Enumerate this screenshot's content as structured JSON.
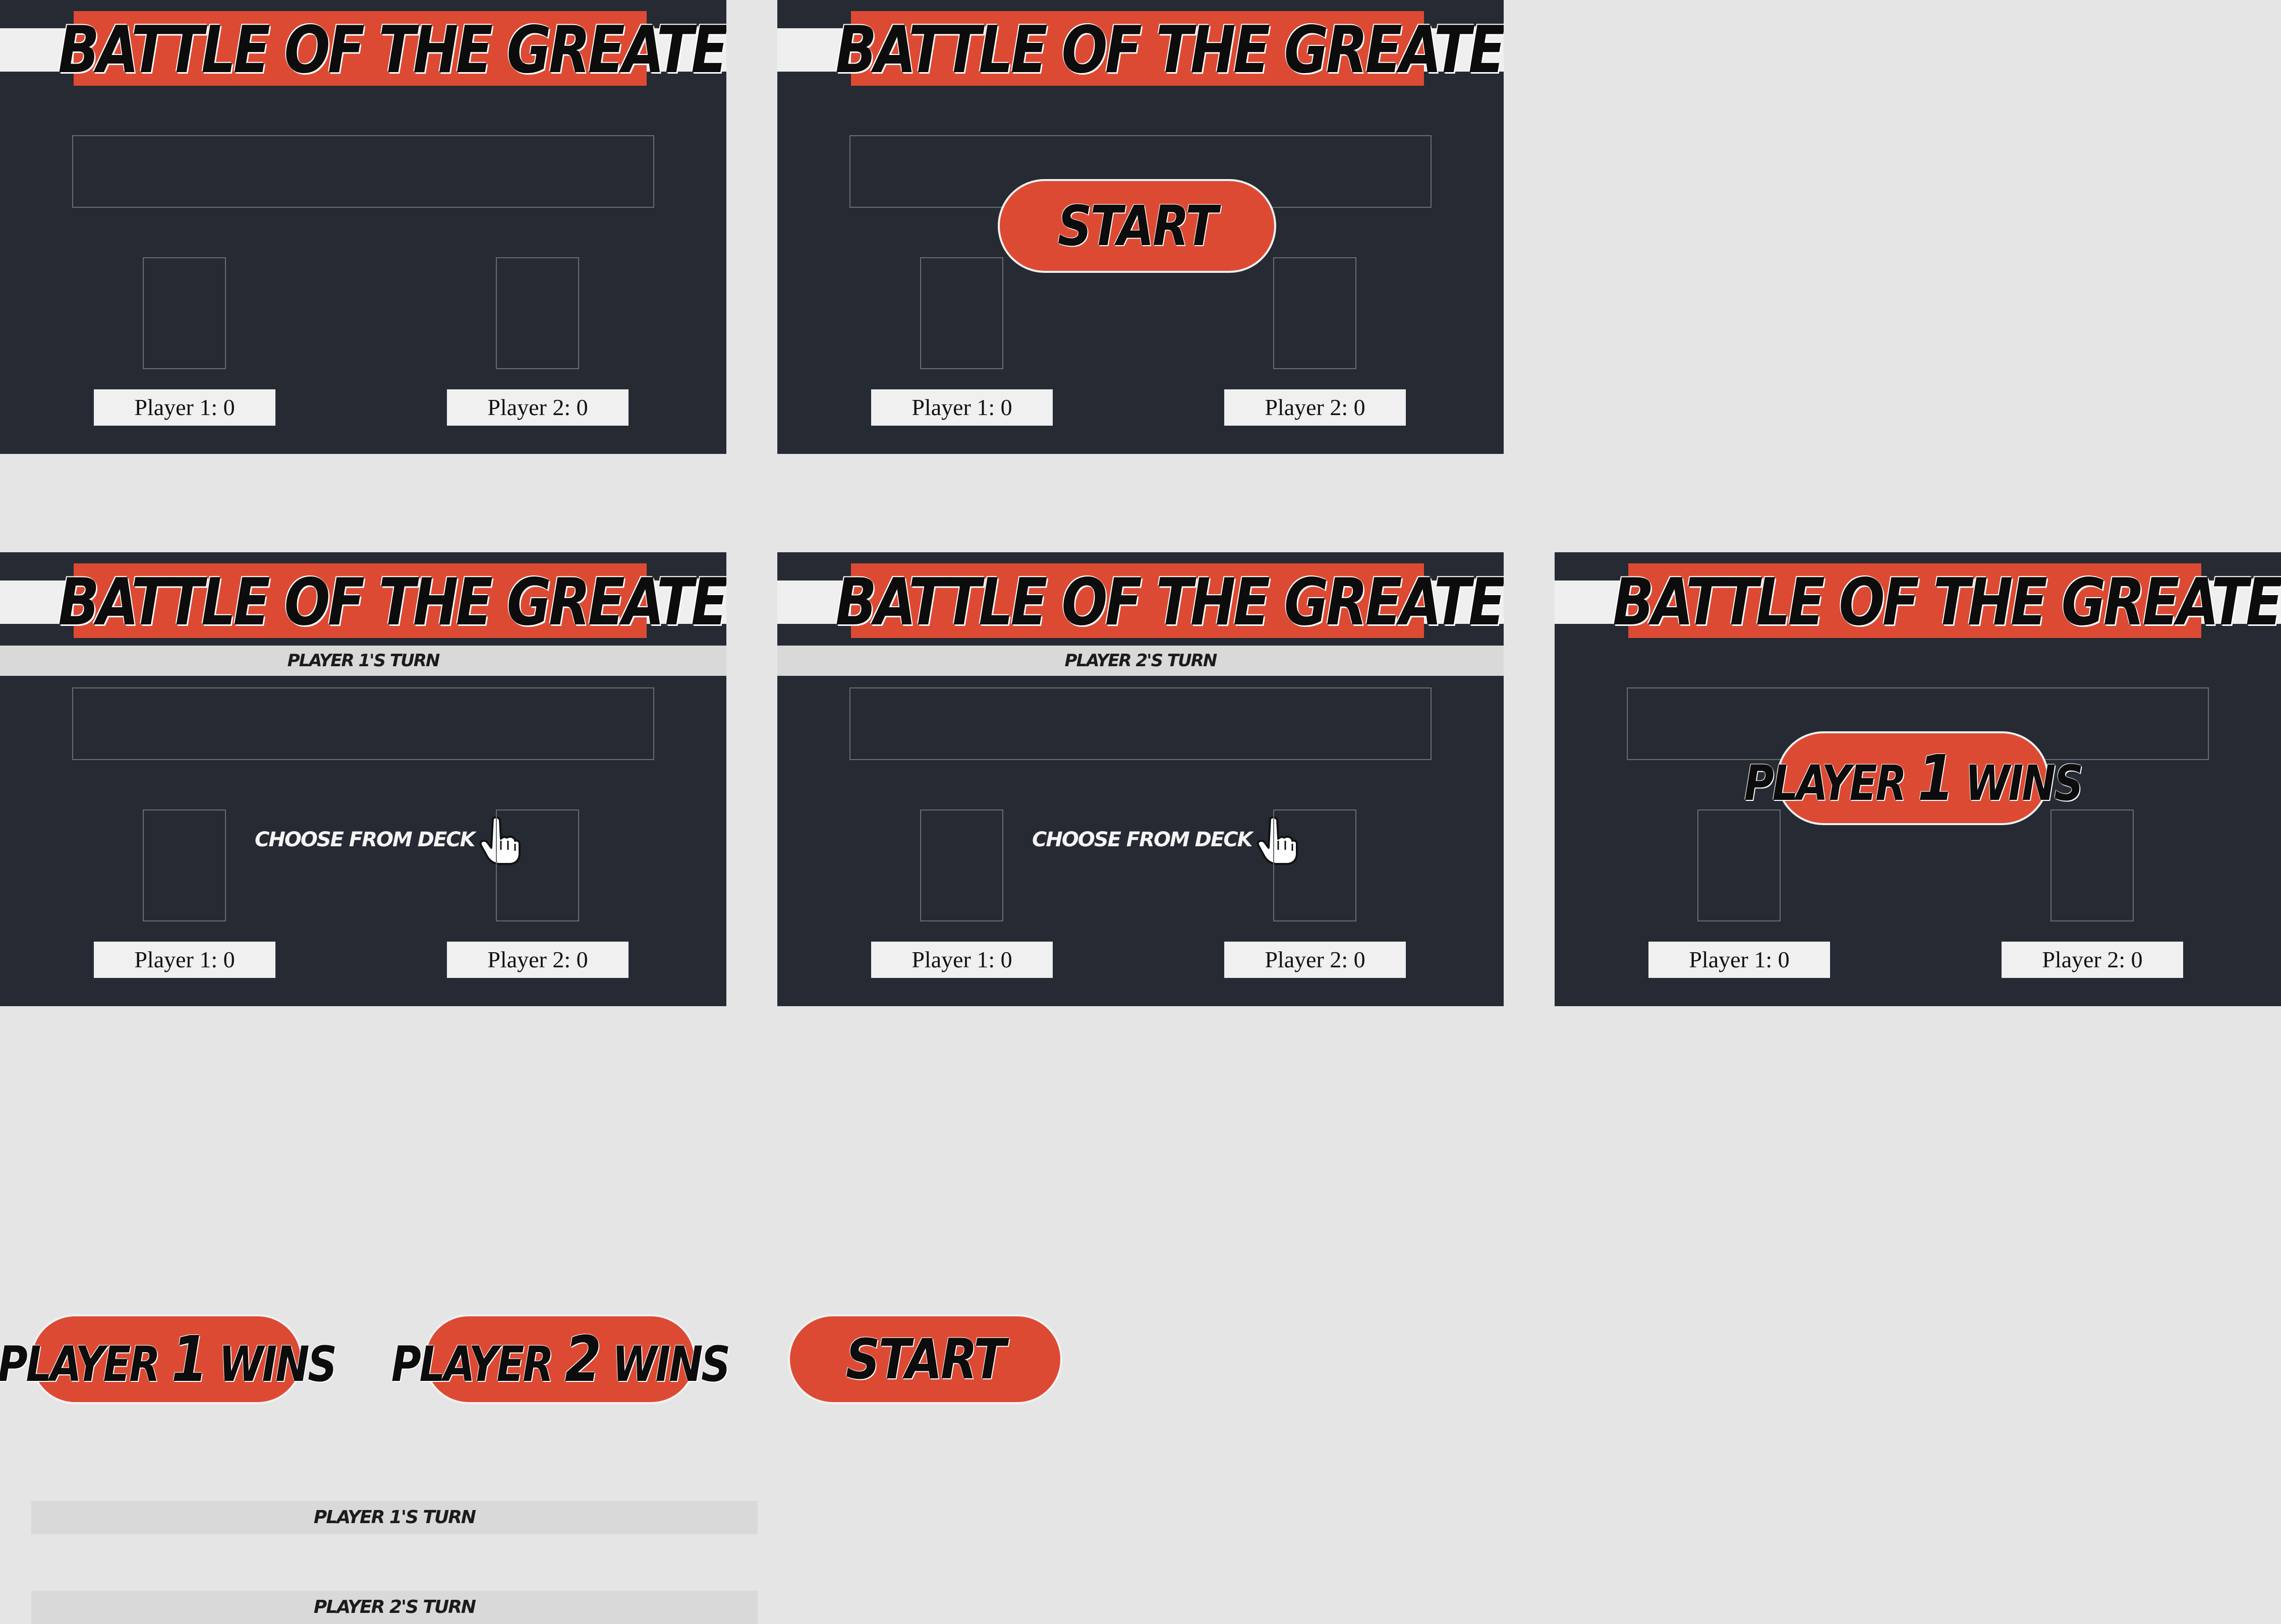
{
  "title": "BATTLE OF THE GREATEST",
  "scores": {
    "player1": "Player 1: 0",
    "player2": "Player 2: 0"
  },
  "turns": {
    "player1": "PLAYER 1'S TURN",
    "player2": "PLAYER 2'S TURN"
  },
  "choose_label": "CHOOSE FROM DECK",
  "start_label": "START",
  "wins": {
    "p1": {
      "prefix": "PLAYER",
      "number": "1",
      "suffix": "WINS"
    },
    "p2": {
      "prefix": "PLAYER",
      "number": "2",
      "suffix": "WINS"
    }
  },
  "colors": {
    "background": "#e5e5e5",
    "panel": "#262a33",
    "accent_red": "#dd4a33",
    "title_band": "#efefef",
    "turn_bar": "#d9d9d9",
    "score_box": "#f0f0f0"
  },
  "icons": {
    "pointer": "pointing-hand-icon"
  }
}
